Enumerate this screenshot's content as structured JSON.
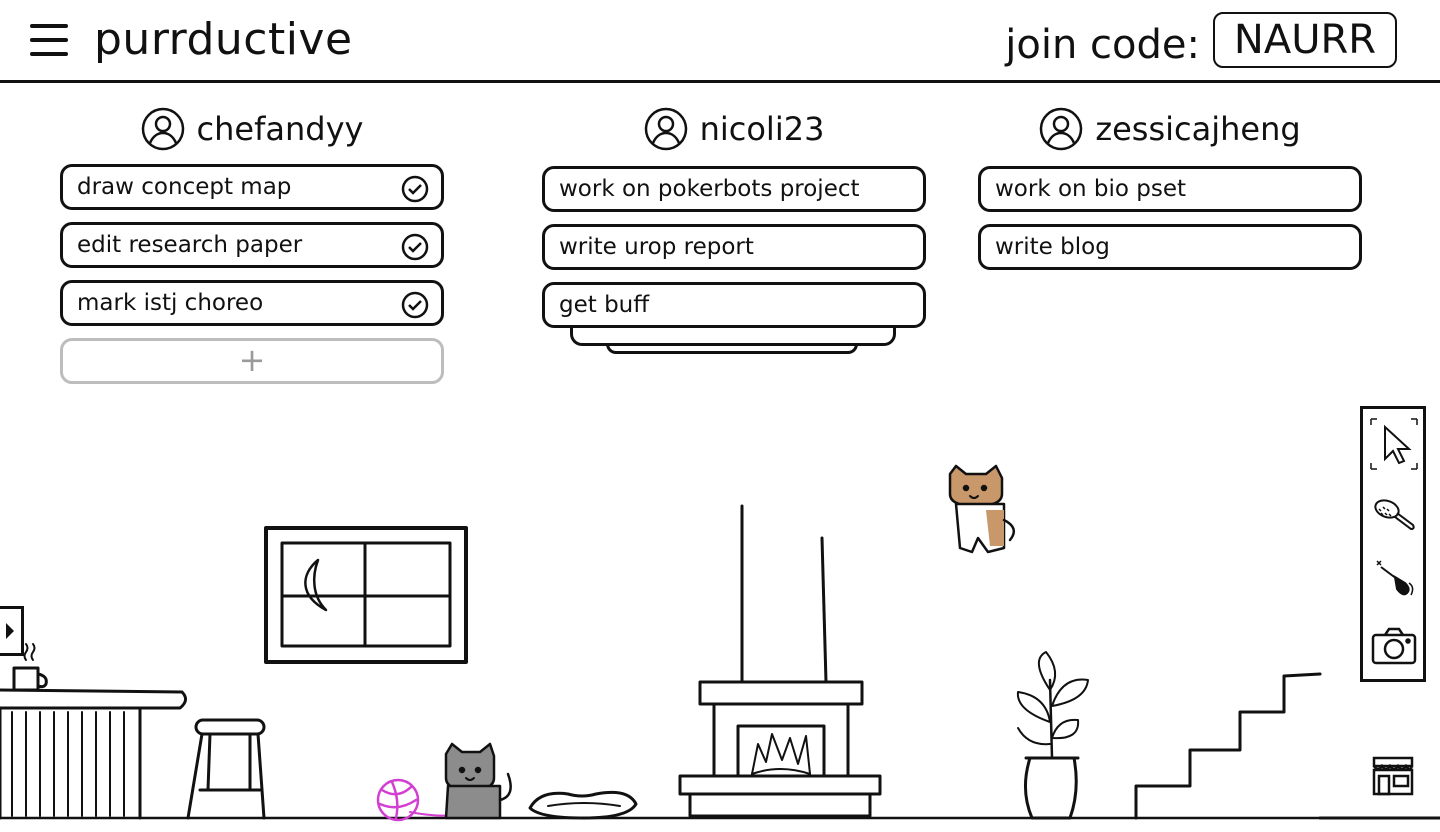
{
  "app": {
    "title": "purrductive",
    "join_code_label": "join code:",
    "join_code": "NAURR"
  },
  "users": [
    {
      "name": "chefandyy",
      "tasks": [
        {
          "label": "draw concept map",
          "done": true
        },
        {
          "label": "edit research paper",
          "done": true
        },
        {
          "label": "mark istj choreo",
          "done": true
        }
      ],
      "add_label": "+"
    },
    {
      "name": "nicoli23",
      "tasks": [
        {
          "label": "work on pokerbots project",
          "done": false
        },
        {
          "label": "write urop report",
          "done": false
        },
        {
          "label": "get buff",
          "done": false
        }
      ]
    },
    {
      "name": "zessicajheng",
      "tasks": [
        {
          "label": "work on bio pset",
          "done": false
        },
        {
          "label": "write blog",
          "done": false
        }
      ]
    }
  ],
  "toolbar": {
    "tools": [
      "cursor-icon",
      "brush-icon",
      "wand-icon",
      "camera-icon"
    ],
    "shop_icon": "shop-icon"
  },
  "colors": {
    "ink": "#111111",
    "add_border": "#bdbdbd",
    "yarn": "#d33fd3",
    "gray_cat": "#8c8c8c",
    "tan_cat": "#c8976a"
  }
}
